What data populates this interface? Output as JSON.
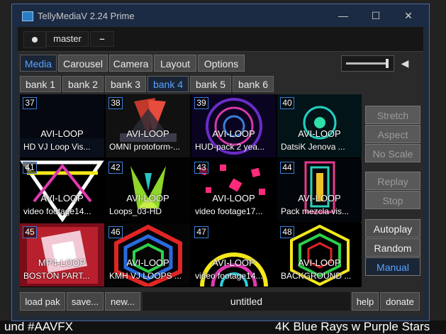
{
  "window": {
    "title": "TellyMediaV 2.24 Prime",
    "minimize": "—",
    "maximize": "☐",
    "close": "✕"
  },
  "topbar": {
    "rec_icon": "record-dot-icon",
    "output": "master",
    "output_toggle": "–"
  },
  "tabs": [
    {
      "label": "Media",
      "active": true
    },
    {
      "label": "Carousel",
      "active": false
    },
    {
      "label": "Camera",
      "active": false
    },
    {
      "label": "Layout",
      "active": false
    },
    {
      "label": "Options",
      "active": false
    }
  ],
  "volume": {
    "level": 1.0,
    "icon": "speaker-icon"
  },
  "banks": [
    {
      "label": "bank 1",
      "active": false
    },
    {
      "label": "bank 2",
      "active": false
    },
    {
      "label": "bank 3",
      "active": false
    },
    {
      "label": "bank 4",
      "active": true
    },
    {
      "label": "bank 5",
      "active": false
    },
    {
      "label": "bank 6",
      "active": false
    }
  ],
  "clips": [
    {
      "num": "37",
      "type": "AVI-LOOP",
      "name": "HD VJ Loop Vis..."
    },
    {
      "num": "38",
      "type": "AVI-LOOP",
      "name": "OMNI protoform-..."
    },
    {
      "num": "39",
      "type": "AVI-LOOP",
      "name": "HUD-pack 2 yea..."
    },
    {
      "num": "40",
      "type": "AVI-LOOP",
      "name": "DatsiK  Jenova ..."
    },
    {
      "num": "41",
      "type": "AVI-LOOP",
      "name": "video footage14..."
    },
    {
      "num": "42",
      "type": "AVI-LOOP",
      "name": "Loops_03-HD"
    },
    {
      "num": "43",
      "type": "AVI-LOOP",
      "name": "video footage17..."
    },
    {
      "num": "44",
      "type": "AVI-LOOP",
      "name": "Pack mezcla vis..."
    },
    {
      "num": "45",
      "type": "MP4-LOOP",
      "name": "BOSTON PART..."
    },
    {
      "num": "46",
      "type": "AVI-LOOP",
      "name": "KMH VJ LOOPS ..."
    },
    {
      "num": "47",
      "type": "AVI-LOOP",
      "name": "video footage14..."
    },
    {
      "num": "48",
      "type": "AVI-LOOP",
      "name": "BACKGROUND ..."
    }
  ],
  "side_buttons": {
    "stretch": "Stretch",
    "aspect": "Aspect",
    "no_scale": "No Scale",
    "replay": "Replay",
    "stop": "Stop",
    "autoplay": "Autoplay",
    "random": "Random",
    "manual": "Manual"
  },
  "bottom": {
    "load_pak": "load pak",
    "save": "save...",
    "new": "new...",
    "pak_name": "untitled",
    "help": "help",
    "donate": "donate"
  },
  "background": {
    "line1": "und #AAVFX",
    "line2": "4K Blue Rays w Purple Stars"
  }
}
